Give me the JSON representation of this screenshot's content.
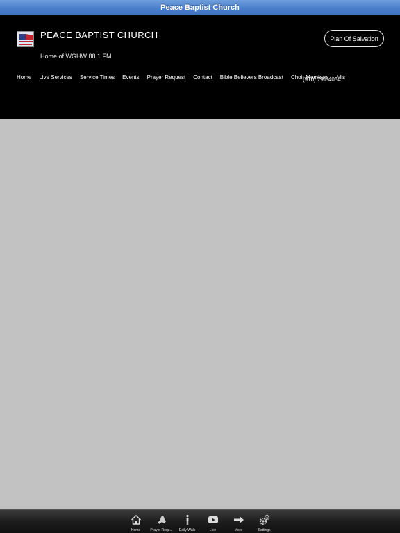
{
  "titlebar": {
    "title": "Peace Baptist Church"
  },
  "header": {
    "site_title": "PEACE BAPTIST CHURCH",
    "subtitle": "Home of  WGHW 88.1 FM",
    "cta_label": "Plan Of Salvation",
    "phone_overlay": "(910) 791-4054",
    "nav": [
      {
        "label": "Home"
      },
      {
        "label": "Live Services"
      },
      {
        "label": "Service Times"
      },
      {
        "label": "Events"
      },
      {
        "label": "Prayer Request"
      },
      {
        "label": "Contact"
      },
      {
        "label": "Bible Believers Broadcast"
      },
      {
        "label": "Choir Members"
      },
      {
        "label": "Mis"
      }
    ]
  },
  "tabbar": {
    "items": [
      {
        "label": "Home",
        "icon": "house-icon"
      },
      {
        "label": "Prayer Requ...",
        "icon": "praying-hands-icon"
      },
      {
        "label": "Daily Walk",
        "icon": "person-walking-icon"
      },
      {
        "label": "Live",
        "icon": "video-play-icon"
      },
      {
        "label": "More",
        "icon": "arrow-right-icon"
      },
      {
        "label": "Settings",
        "icon": "gears-icon"
      }
    ]
  },
  "colors": {
    "titlebar": "#4a7fcc",
    "header_bg": "#000000",
    "content_bg": "#c2c2c2",
    "tabbar_bg": "#1d1d1d"
  }
}
